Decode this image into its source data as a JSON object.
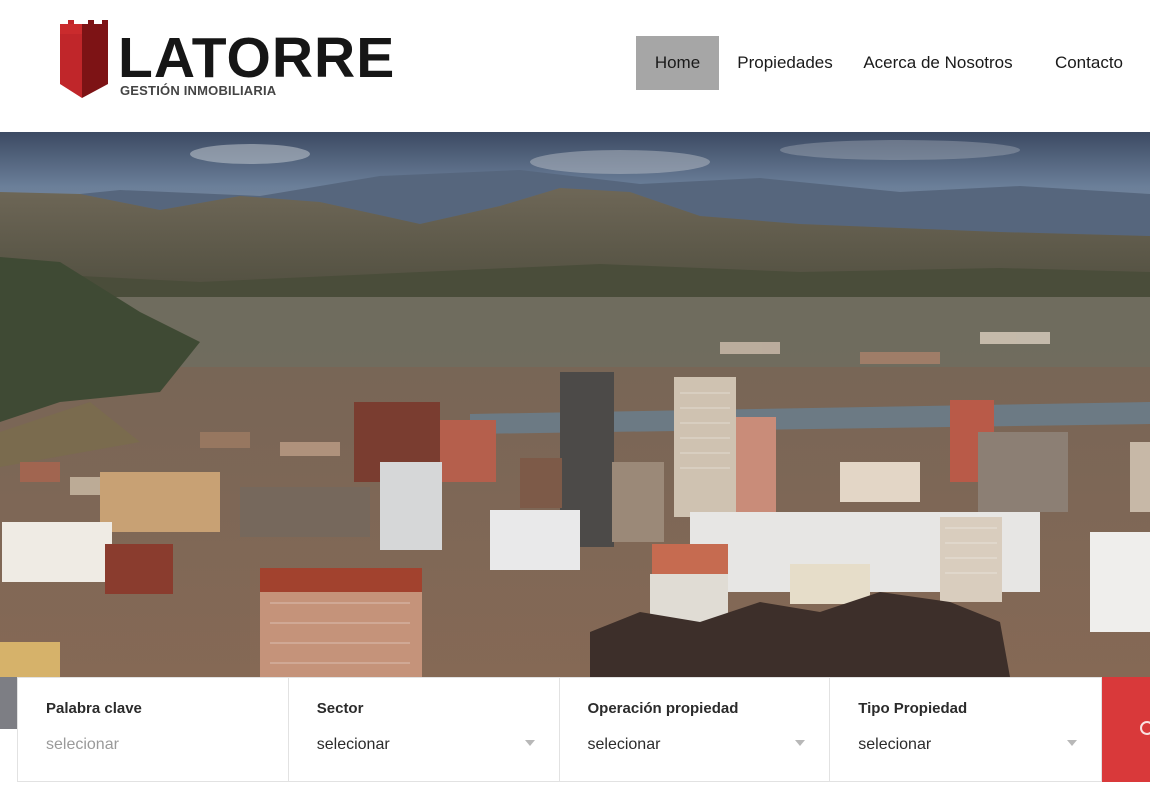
{
  "brand": {
    "name": "LATORRE",
    "tagline": "GESTIÓN INMOBILIARIA",
    "color": "#b3211f"
  },
  "nav": {
    "items": [
      {
        "label": "Home",
        "active": true
      },
      {
        "label": "Propiedades",
        "active": false
      },
      {
        "label": "Acerca de Nosotros",
        "active": false
      },
      {
        "label": "Contacto",
        "active": false
      }
    ]
  },
  "hero": {
    "image": "city-skyline-photo"
  },
  "search": {
    "fields": [
      {
        "label": "Palabra clave",
        "placeholder": "selecionar",
        "type": "text"
      },
      {
        "label": "Sector",
        "value": "selecionar",
        "type": "select"
      },
      {
        "label": "Operación propiedad",
        "value": "selecionar",
        "type": "select"
      },
      {
        "label": "Tipo Propiedad",
        "value": "selecionar",
        "type": "select"
      }
    ],
    "button_color": "#d9393a",
    "button_icon": "search-icon"
  }
}
